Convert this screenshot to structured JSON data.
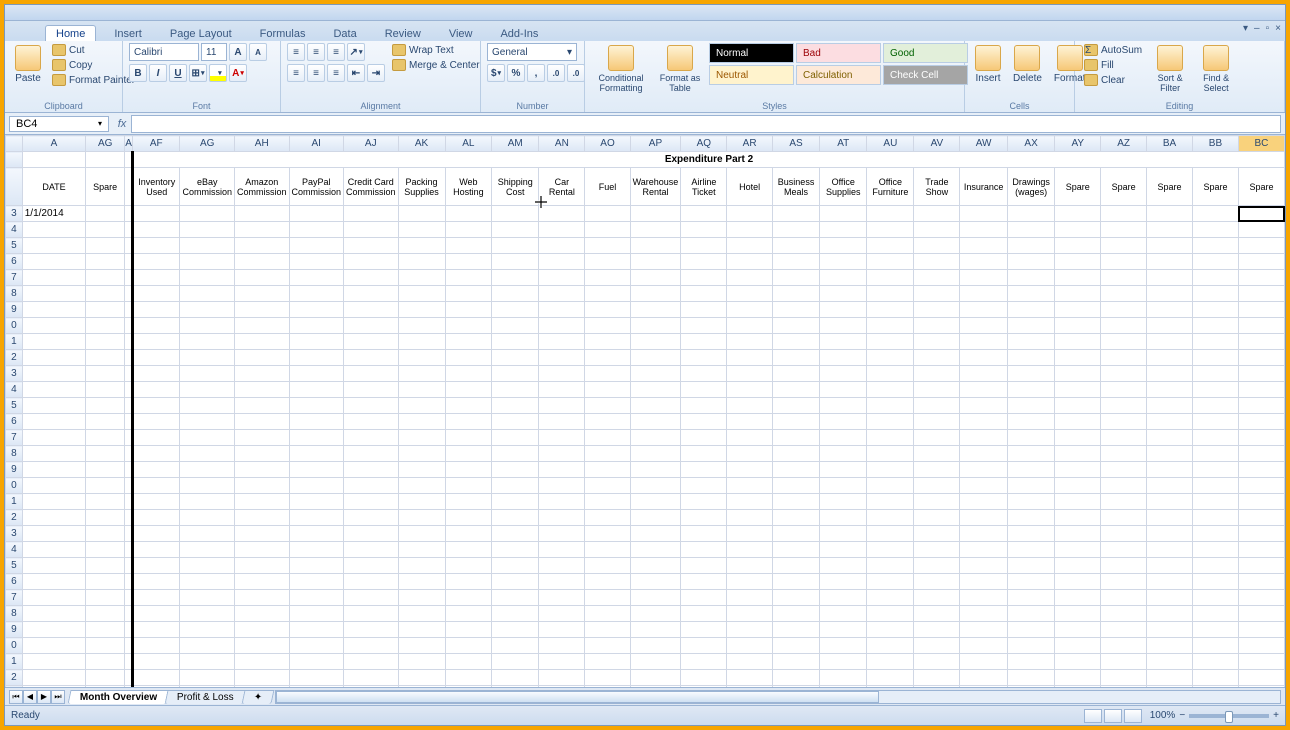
{
  "tabs": [
    "Home",
    "Insert",
    "Page Layout",
    "Formulas",
    "Data",
    "Review",
    "View",
    "Add-Ins"
  ],
  "activeTab": "Home",
  "ribbon": {
    "clipboard": {
      "paste": "Paste",
      "cut": "Cut",
      "copy": "Copy",
      "painter": "Format Painter",
      "label": "Clipboard"
    },
    "font": {
      "name": "Calibri",
      "size": "11",
      "label": "Font"
    },
    "alignment": {
      "wrap": "Wrap Text",
      "merge": "Merge & Center",
      "label": "Alignment"
    },
    "number": {
      "fmt": "General",
      "label": "Number"
    },
    "styles": {
      "cond": "Conditional Formatting",
      "table": "Format as Table",
      "normal": "Normal",
      "bad": "Bad",
      "good": "Good",
      "neutral": "Neutral",
      "calc": "Calculation",
      "check": "Check Cell",
      "label": "Styles"
    },
    "cells": {
      "insert": "Insert",
      "delete": "Delete",
      "format": "Format",
      "label": "Cells"
    },
    "editing": {
      "autosum": "AutoSum",
      "fill": "Fill",
      "clear": "Clear",
      "sort": "Sort & Filter",
      "find": "Find & Select",
      "label": "Editing"
    }
  },
  "cellRef": "BC4",
  "columnLetters": [
    "A",
    "AG",
    "A",
    "AF",
    "AG",
    "AH",
    "AI",
    "AJ",
    "AK",
    "AL",
    "AM",
    "AN",
    "AO",
    "AP",
    "AQ",
    "AR",
    "AS",
    "AT",
    "AU",
    "AV",
    "AW",
    "AX",
    "AY",
    "AZ",
    "BA",
    "BB",
    "BC"
  ],
  "selectedCol": 26,
  "mergedTitle": "Expenditure Part 2",
  "spareLabel": "Spare",
  "headerRow": [
    "DATE",
    "Spare",
    "",
    "Inventory Used",
    "eBay Commission",
    "Amazon Commission",
    "PayPal Commission",
    "Credit Card Commission",
    "Packing Supplies",
    "Web Hosting",
    "Shipping Cost",
    "Car Rental",
    "Fuel",
    "Warehouse Rental",
    "Airline Ticket",
    "Hotel",
    "Business Meals",
    "Office Supplies",
    "Office Furniture",
    "Trade Show",
    "Insurance",
    "Drawings (wages)",
    "Spare",
    "Spare",
    "Spare",
    "Spare",
    "Spare"
  ],
  "dateValue": "1/1/2014",
  "rowNumbers": [
    "",
    "",
    "",
    "3",
    "4",
    "5",
    "6",
    "7",
    "8",
    "9",
    "0",
    "1",
    "2",
    "3",
    "4",
    "5",
    "6",
    "7",
    "8",
    "9",
    "0",
    "1",
    "2",
    "3",
    "4",
    "5",
    "6",
    "7",
    "8",
    "9",
    "0",
    "1",
    "2"
  ],
  "sheetTabs": [
    "Month Overview",
    "Profit & Loss"
  ],
  "activeSheet": 0,
  "status": "Ready",
  "zoom": "100%"
}
